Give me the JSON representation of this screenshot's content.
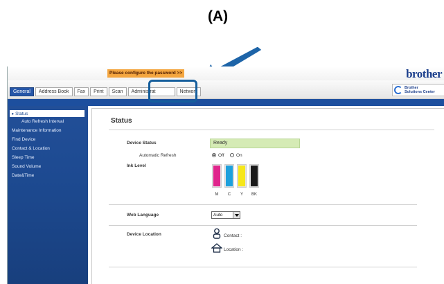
{
  "caption": "(A)",
  "header": {
    "password_warning": "Please configure the password >>",
    "brand": "brother",
    "solutions_center_line1": "Brother",
    "solutions_center_line2": "Solutions Center"
  },
  "tabs": [
    {
      "label": "General",
      "active": true
    },
    {
      "label": "Address Book"
    },
    {
      "label": "Fax"
    },
    {
      "label": "Print"
    },
    {
      "label": "Scan"
    },
    {
      "label": "Administrat"
    },
    {
      "label": "Network"
    }
  ],
  "sidebar": {
    "items": [
      {
        "label": "Status",
        "active": true
      },
      {
        "label": "Auto Refresh Interval"
      },
      {
        "label": "Maintenance Information"
      },
      {
        "label": "Find Device"
      },
      {
        "label": "Contact & Location"
      },
      {
        "label": "Sleep Time"
      },
      {
        "label": "Sound Volume"
      },
      {
        "label": "Date&Time"
      }
    ]
  },
  "content": {
    "title": "Status",
    "device_status_label": "Device Status",
    "device_status_value": "Ready",
    "auto_refresh_label": "Automatic Refresh",
    "auto_refresh_off": "Off",
    "auto_refresh_on": "On",
    "auto_refresh_selected": "Off",
    "ink_level_label": "Ink Level",
    "inks": [
      {
        "label": "M",
        "color": "#e0258c"
      },
      {
        "label": "C",
        "color": "#1ea0dc"
      },
      {
        "label": "Y",
        "color": "#f6e71a"
      },
      {
        "label": "BK",
        "color": "#1a1a1a"
      }
    ],
    "web_language_label": "Web Language",
    "web_language_value": "Auto",
    "device_location_label": "Device Location",
    "contact_label": "Contact :",
    "location_label": "Location :"
  },
  "colors": {
    "highlight": "#155e9c",
    "arrow": "#1d64a8"
  }
}
